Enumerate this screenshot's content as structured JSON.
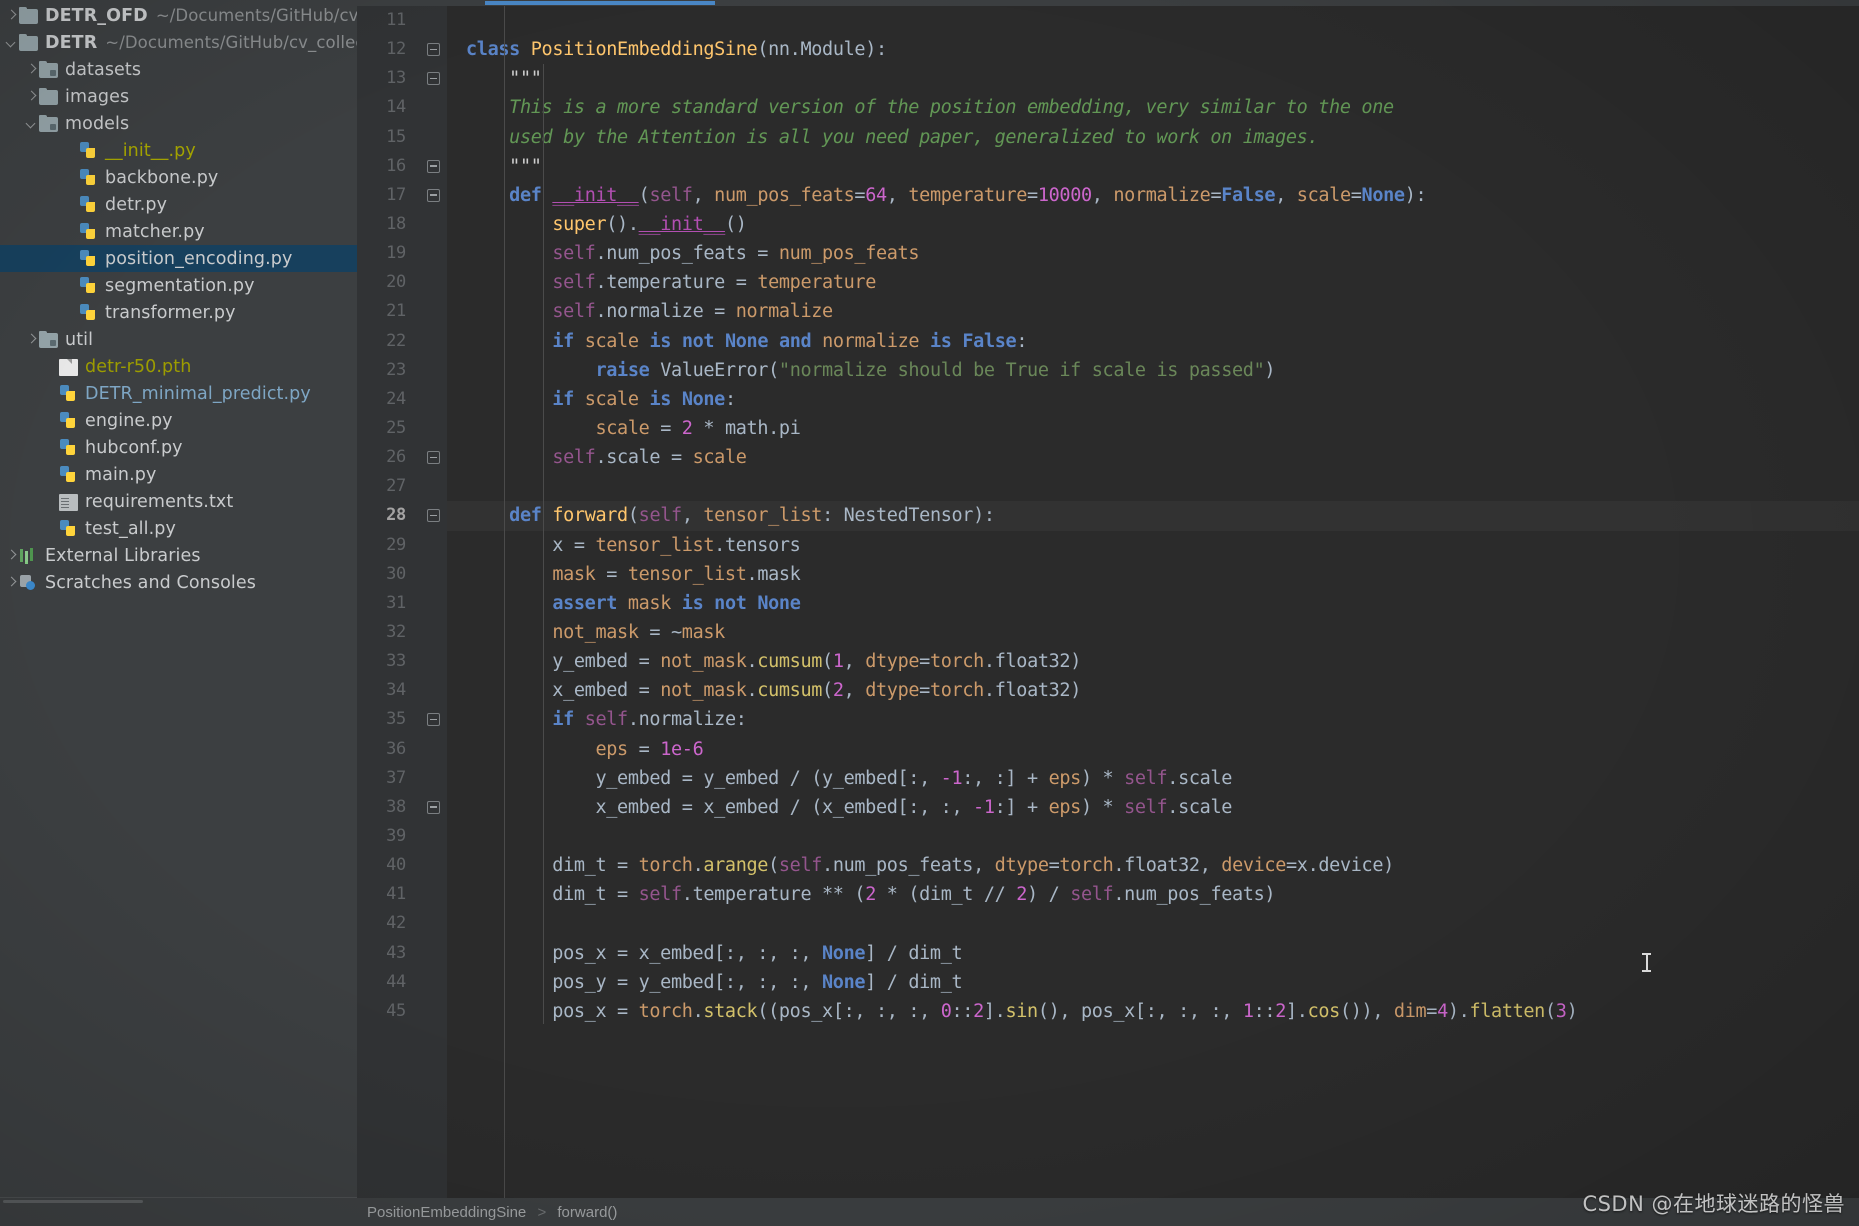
{
  "window": {
    "title": "position_encoding.py",
    "accent_color": "#4a88c7",
    "editor_bg": "#2b2b2b",
    "sidebar_bg": "#3c3f41",
    "selection_bg": "#17405d"
  },
  "sidebar": {
    "items": [
      {
        "indent": 0,
        "arrow": "right",
        "icon": "folder-icon",
        "label": "DETR_OFD",
        "bold": true,
        "path": "~/Documents/GitHub/cv_c",
        "selected": false,
        "style": "normal"
      },
      {
        "indent": 0,
        "arrow": "down",
        "icon": "folder-icon",
        "label": "DETR",
        "bold": true,
        "path": "~/Documents/GitHub/cv_collect",
        "selected": false,
        "style": "normal"
      },
      {
        "indent": 1,
        "arrow": "right",
        "icon": "folder-src-icon",
        "label": "datasets",
        "bold": false,
        "path": "",
        "selected": false,
        "style": "normal"
      },
      {
        "indent": 1,
        "arrow": "right",
        "icon": "folder-icon",
        "label": "images",
        "bold": false,
        "path": "",
        "selected": false,
        "style": "normal"
      },
      {
        "indent": 1,
        "arrow": "down",
        "icon": "folder-src-icon",
        "label": "models",
        "bold": false,
        "path": "",
        "selected": false,
        "style": "normal"
      },
      {
        "indent": 3,
        "arrow": "none",
        "icon": "python-file-icon",
        "label": "__init__.py",
        "bold": false,
        "path": "",
        "selected": false,
        "style": "excluded"
      },
      {
        "indent": 3,
        "arrow": "none",
        "icon": "python-file-icon",
        "label": "backbone.py",
        "bold": false,
        "path": "",
        "selected": false,
        "style": "normal"
      },
      {
        "indent": 3,
        "arrow": "none",
        "icon": "python-file-icon",
        "label": "detr.py",
        "bold": false,
        "path": "",
        "selected": false,
        "style": "normal"
      },
      {
        "indent": 3,
        "arrow": "none",
        "icon": "python-file-icon",
        "label": "matcher.py",
        "bold": false,
        "path": "",
        "selected": false,
        "style": "normal"
      },
      {
        "indent": 3,
        "arrow": "none",
        "icon": "python-file-icon",
        "label": "position_encoding.py",
        "bold": false,
        "path": "",
        "selected": true,
        "style": "normal"
      },
      {
        "indent": 3,
        "arrow": "none",
        "icon": "python-file-icon",
        "label": "segmentation.py",
        "bold": false,
        "path": "",
        "selected": false,
        "style": "normal"
      },
      {
        "indent": 3,
        "arrow": "none",
        "icon": "python-file-icon",
        "label": "transformer.py",
        "bold": false,
        "path": "",
        "selected": false,
        "style": "normal"
      },
      {
        "indent": 1,
        "arrow": "right",
        "icon": "folder-src-icon",
        "label": "util",
        "bold": false,
        "path": "",
        "selected": false,
        "style": "normal"
      },
      {
        "indent": 2,
        "arrow": "none",
        "icon": "file-icon",
        "label": "detr-r50.pth",
        "bold": false,
        "path": "",
        "selected": false,
        "style": "excluded-file"
      },
      {
        "indent": 2,
        "arrow": "none",
        "icon": "python-file-icon",
        "label": "DETR_minimal_predict.py",
        "bold": false,
        "path": "",
        "selected": false,
        "style": "blue"
      },
      {
        "indent": 2,
        "arrow": "none",
        "icon": "python-file-icon",
        "label": "engine.py",
        "bold": false,
        "path": "",
        "selected": false,
        "style": "normal"
      },
      {
        "indent": 2,
        "arrow": "none",
        "icon": "python-file-icon",
        "label": "hubconf.py",
        "bold": false,
        "path": "",
        "selected": false,
        "style": "normal"
      },
      {
        "indent": 2,
        "arrow": "none",
        "icon": "python-file-icon",
        "label": "main.py",
        "bold": false,
        "path": "",
        "selected": false,
        "style": "normal"
      },
      {
        "indent": 2,
        "arrow": "none",
        "icon": "txt-file-icon",
        "label": "requirements.txt",
        "bold": false,
        "path": "",
        "selected": false,
        "style": "normal"
      },
      {
        "indent": 2,
        "arrow": "none",
        "icon": "python-file-icon",
        "label": "test_all.py",
        "bold": false,
        "path": "",
        "selected": false,
        "style": "normal"
      },
      {
        "indent": 0,
        "arrow": "right",
        "icon": "external-libraries-icon",
        "label": "External Libraries",
        "bold": false,
        "path": "",
        "selected": false,
        "style": "normal"
      },
      {
        "indent": 0,
        "arrow": "right",
        "icon": "scratches-icon",
        "label": "Scratches and Consoles",
        "bold": false,
        "path": "",
        "selected": false,
        "style": "normal"
      }
    ]
  },
  "editor": {
    "current_line": 28,
    "first_line": 11,
    "last_line": 45,
    "lines": [
      {
        "n": 11,
        "fold": false,
        "text": ""
      },
      {
        "n": 12,
        "fold": true,
        "text": "class PositionEmbeddingSine(nn.Module):"
      },
      {
        "n": 13,
        "fold": true,
        "text": "    \"\"\""
      },
      {
        "n": 14,
        "fold": false,
        "text": "    This is a more standard version of the position embedding, very similar to the one"
      },
      {
        "n": 15,
        "fold": false,
        "text": "    used by the Attention is all you need paper, generalized to work on images."
      },
      {
        "n": 16,
        "fold": true,
        "text": "    \"\"\""
      },
      {
        "n": 17,
        "fold": true,
        "text": "    def __init__(self, num_pos_feats=64, temperature=10000, normalize=False, scale=None):"
      },
      {
        "n": 18,
        "fold": false,
        "text": "        super().__init__()"
      },
      {
        "n": 19,
        "fold": false,
        "text": "        self.num_pos_feats = num_pos_feats"
      },
      {
        "n": 20,
        "fold": false,
        "text": "        self.temperature = temperature"
      },
      {
        "n": 21,
        "fold": false,
        "text": "        self.normalize = normalize"
      },
      {
        "n": 22,
        "fold": false,
        "text": "        if scale is not None and normalize is False:"
      },
      {
        "n": 23,
        "fold": false,
        "text": "            raise ValueError(\"normalize should be True if scale is passed\")"
      },
      {
        "n": 24,
        "fold": false,
        "text": "        if scale is None:"
      },
      {
        "n": 25,
        "fold": false,
        "text": "            scale = 2 * math.pi"
      },
      {
        "n": 26,
        "fold": true,
        "text": "        self.scale = scale"
      },
      {
        "n": 27,
        "fold": false,
        "text": ""
      },
      {
        "n": 28,
        "fold": true,
        "text": "    def forward(self, tensor_list: NestedTensor):"
      },
      {
        "n": 29,
        "fold": false,
        "text": "        x = tensor_list.tensors"
      },
      {
        "n": 30,
        "fold": false,
        "text": "        mask = tensor_list.mask"
      },
      {
        "n": 31,
        "fold": false,
        "text": "        assert mask is not None"
      },
      {
        "n": 32,
        "fold": false,
        "text": "        not_mask = ~mask"
      },
      {
        "n": 33,
        "fold": false,
        "text": "        y_embed = not_mask.cumsum(1, dtype=torch.float32)"
      },
      {
        "n": 34,
        "fold": false,
        "text": "        x_embed = not_mask.cumsum(2, dtype=torch.float32)"
      },
      {
        "n": 35,
        "fold": true,
        "text": "        if self.normalize:"
      },
      {
        "n": 36,
        "fold": false,
        "text": "            eps = 1e-6"
      },
      {
        "n": 37,
        "fold": false,
        "text": "            y_embed = y_embed / (y_embed[:, -1:, :] + eps) * self.scale"
      },
      {
        "n": 38,
        "fold": true,
        "text": "            x_embed = x_embed / (x_embed[:, :, -1:] + eps) * self.scale"
      },
      {
        "n": 39,
        "fold": false,
        "text": ""
      },
      {
        "n": 40,
        "fold": false,
        "text": "        dim_t = torch.arange(self.num_pos_feats, dtype=torch.float32, device=x.device)"
      },
      {
        "n": 41,
        "fold": false,
        "text": "        dim_t = self.temperature ** (2 * (dim_t // 2) / self.num_pos_feats)"
      },
      {
        "n": 42,
        "fold": false,
        "text": ""
      },
      {
        "n": 43,
        "fold": false,
        "text": "        pos_x = x_embed[:, :, :, None] / dim_t"
      },
      {
        "n": 44,
        "fold": false,
        "text": "        pos_y = y_embed[:, :, :, None] / dim_t"
      },
      {
        "n": 45,
        "fold": false,
        "text": "        pos_x = torch.stack((pos_x[:, :, :, 0::2].sin(), pos_x[:, :, :, 1::2].cos()), dim=4).flatten(3)"
      }
    ]
  },
  "breadcrumb": {
    "class_name": "PositionEmbeddingSine",
    "separator": ">",
    "method_name": "forward()"
  },
  "watermark": {
    "text": "CSDN @在地球迷路的怪兽"
  }
}
